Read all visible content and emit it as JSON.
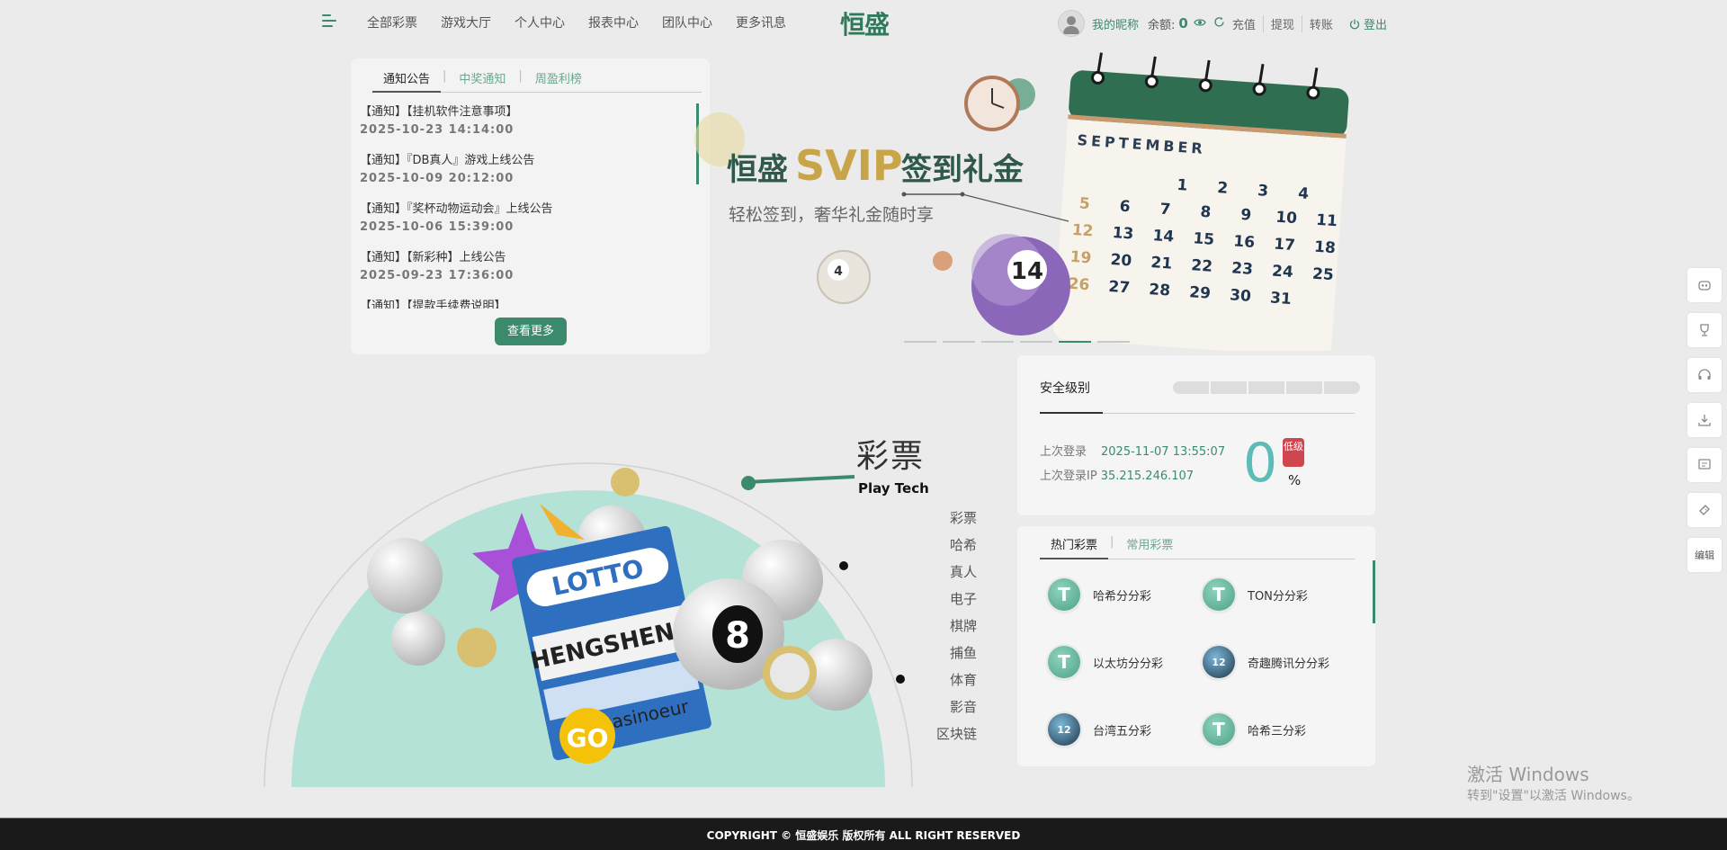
{
  "nav": {
    "items": [
      "全部彩票",
      "游戏大厅",
      "个人中心",
      "报表中心",
      "团队中心",
      "更多讯息"
    ],
    "logo": "恒盛"
  },
  "user": {
    "nickname": "我的昵称",
    "balance_label": "余额:",
    "balance": "0",
    "links": [
      "充值",
      "提现",
      "转账"
    ],
    "logout": "登出"
  },
  "notice": {
    "tabs": [
      "通知公告",
      "中奖通知",
      "周盈利榜"
    ],
    "items": [
      {
        "title": "【通知】【挂机软件注意事项】",
        "date": "2025-10-23 14:14:00"
      },
      {
        "title": "【通知】『DB真人』游戏上线公告",
        "date": "2025-10-09 20:12:00"
      },
      {
        "title": "【通知】『奖杯动物运动会』上线公告",
        "date": "2025-10-06 15:39:00"
      },
      {
        "title": "【通知】【新彩种】上线公告",
        "date": "2025-09-23 17:36:00"
      },
      {
        "title": "【通知】【提款手续费说明】",
        "date": ""
      }
    ],
    "more_label": "查看更多"
  },
  "banner": {
    "brand": "恒盛",
    "svip": "SVIP",
    "title_tail": "签到礼金",
    "subtitle": "轻松签到，奢华礼金随时享",
    "month": "SEPTEMBER",
    "ball_number": "14",
    "small_ball_number": "4",
    "calendar_rows": [
      [
        "5",
        "6",
        "7",
        "8",
        "9",
        "10",
        "11"
      ],
      [
        "12",
        "13",
        "14",
        "15",
        "16",
        "17",
        "18"
      ],
      [
        "19",
        "20",
        "21",
        "22",
        "23",
        "24",
        "25"
      ],
      [
        "26",
        "27",
        "28",
        "29",
        "30",
        "31"
      ]
    ],
    "calendar_top": [
      "1",
      "2",
      "3",
      "4"
    ],
    "dots_total": 6,
    "dots_active": 4
  },
  "security": {
    "title": "安全级别",
    "last_login_label": "上次登录",
    "last_login": "2025-11-07 13:55:07",
    "last_ip_label": "上次登录IP",
    "last_ip": "35.215.246.107",
    "level": "0",
    "level_badge": "低级",
    "percent": "%",
    "bars_total": 5
  },
  "hot": {
    "tabs": [
      "热门彩票",
      "常用彩票"
    ],
    "items": [
      {
        "name": "哈希分分彩",
        "icon": "T"
      },
      {
        "name": "TON分分彩",
        "icon": "T"
      },
      {
        "name": "以太坊分分彩",
        "icon": "T"
      },
      {
        "name": "奇趣腾讯分分彩",
        "icon": "12"
      },
      {
        "name": "台湾五分彩",
        "icon": "12"
      },
      {
        "name": "哈希三分彩",
        "icon": "T"
      }
    ]
  },
  "category": {
    "title": "彩票",
    "subtitle": "Play Tech",
    "list": [
      "彩票",
      "哈希",
      "真人",
      "电子",
      "棋牌",
      "捕鱼",
      "体育",
      "影音",
      "区块链"
    ],
    "go_label": "GO",
    "ticket_text": "LOTTO",
    "ticket_brand": "HENGSHENG",
    "ticket_casino": "casinoeur",
    "ball_8": "8"
  },
  "sidebar": {
    "edit_label": "编辑"
  },
  "watermark": {
    "line1": "激活 Windows",
    "line2": "转到\"设置\"以激活 Windows。"
  },
  "footer": {
    "text": "COPYRIGHT © 恒盛娱乐 版权所有 ALL RIGHT RESERVED"
  },
  "colors": {
    "accent": "#3c8a6c",
    "teal": "#5bbcb8",
    "danger": "#d0464f",
    "gold": "#c9a54a"
  }
}
